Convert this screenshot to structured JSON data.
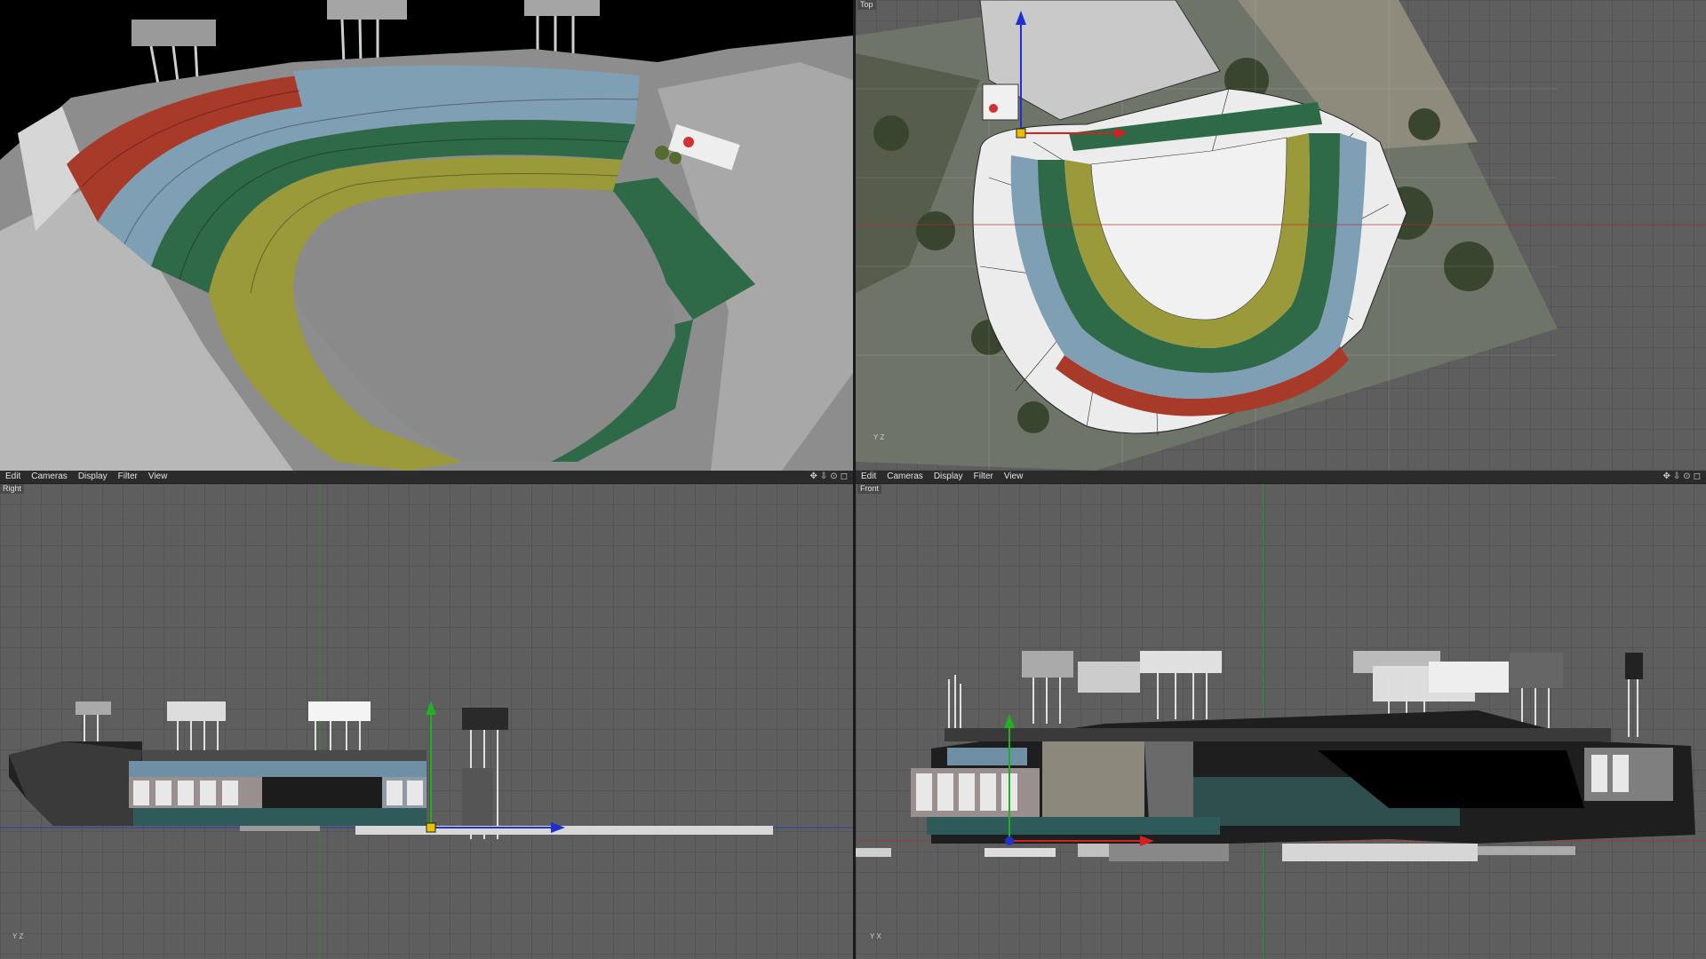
{
  "menubar_left": {
    "items": [
      "Edit",
      "Cameras",
      "Display",
      "Filter",
      "View"
    ],
    "icons": [
      "move-icon",
      "down-arrow-icon",
      "zoom-icon",
      "maximize-icon"
    ]
  },
  "menubar_right": {
    "items": [
      "Edit",
      "Cameras",
      "Display",
      "Filter",
      "View"
    ],
    "icons": [
      "move-icon",
      "down-arrow-icon",
      "zoom-icon",
      "maximize-icon"
    ]
  },
  "viewports": {
    "perspective": {
      "label": ""
    },
    "top": {
      "label": "Top"
    },
    "right": {
      "label": "Right"
    },
    "front": {
      "label": "Front"
    }
  },
  "gizmo": {
    "y": "Y",
    "z": "Z",
    "x": "X"
  },
  "colors": {
    "viewport_bg": "#5e5e5e",
    "perspective_bg": "#000000",
    "menu_bg": "#2b2b2b",
    "seats_red": "#a83a2a",
    "seats_blue": "#7f9fb5",
    "seats_green": "#2f6a48",
    "seats_yellow": "#9a9a3a",
    "axis_x": "#d42020",
    "axis_y": "#20b020",
    "axis_z": "#2030d0"
  }
}
